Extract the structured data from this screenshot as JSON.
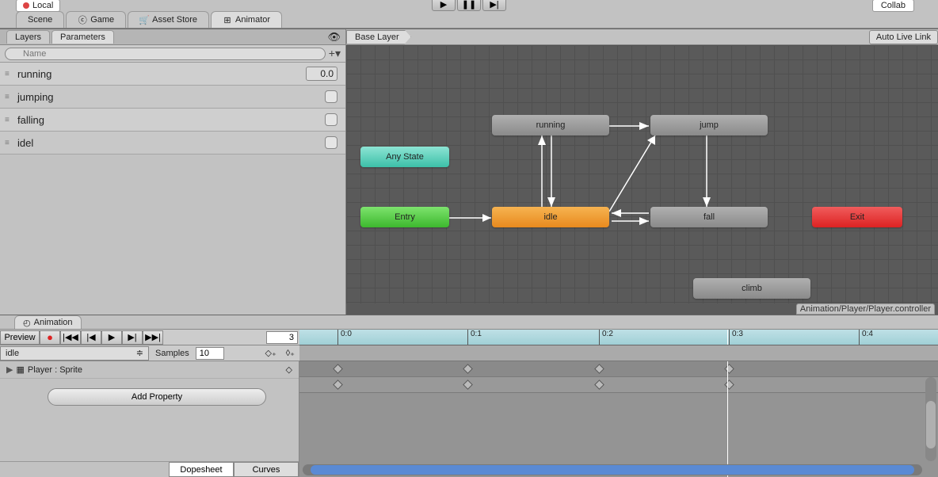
{
  "topbar": {
    "local": "Local",
    "play": "▶",
    "pause": "❚❚",
    "step": "▶|",
    "collab": "Collab"
  },
  "tabs": [
    {
      "label": "Scene",
      "icon": ""
    },
    {
      "label": "Game",
      "icon": "ⓒ"
    },
    {
      "label": "Asset Store",
      "icon": "🛒"
    },
    {
      "label": "Animator",
      "icon": "⊞",
      "active": true
    }
  ],
  "leftPanel": {
    "tabs": {
      "layers": "Layers",
      "parameters": "Parameters"
    },
    "searchPlaceholder": "Name",
    "params": [
      {
        "name": "running",
        "value": "0.0",
        "type": "float"
      },
      {
        "name": "jumping",
        "type": "bool"
      },
      {
        "name": "falling",
        "type": "bool"
      },
      {
        "name": "idel",
        "type": "bool"
      }
    ]
  },
  "graph": {
    "breadcrumb": "Base Layer",
    "autoLiveLink": "Auto Live Link",
    "assetPath": "Animation/Player/Player.controller",
    "states": {
      "anyState": "Any State",
      "entry": "Entry",
      "running": "running",
      "jump": "jump",
      "idle": "idle",
      "fall": "fall",
      "exit": "Exit",
      "climb": "climb"
    }
  },
  "animation": {
    "tabLabel": "Animation",
    "preview": "Preview",
    "frame": "3",
    "clipName": "idle",
    "samplesLabel": "Samples",
    "samples": "10",
    "propertyTrack": "Player : Sprite",
    "addProperty": "Add Property",
    "dopesheet": "Dopesheet",
    "curves": "Curves",
    "timeTicks": [
      "0:0",
      "0:1",
      "0:2",
      "0:3",
      "0:4"
    ]
  }
}
